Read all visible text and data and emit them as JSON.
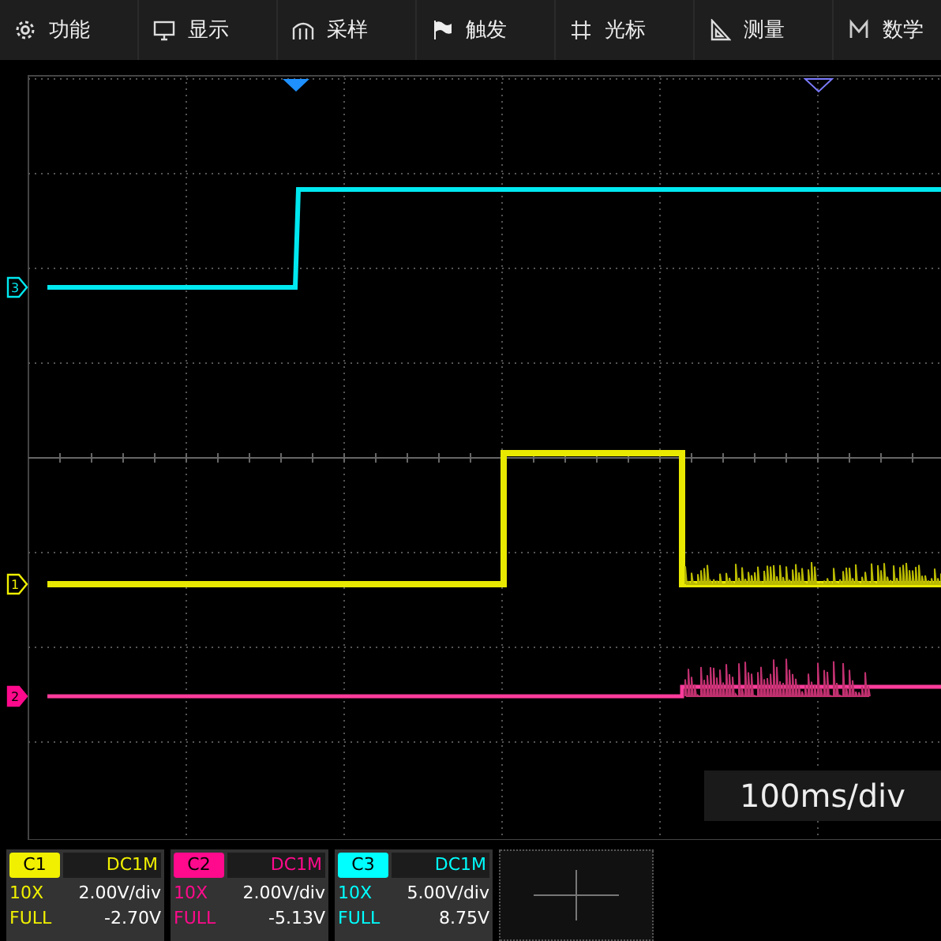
{
  "menu": [
    {
      "label": "功能"
    },
    {
      "label": "显示"
    },
    {
      "label": "采样"
    },
    {
      "label": "触发"
    },
    {
      "label": "光标"
    },
    {
      "label": "测量"
    },
    {
      "label": "数学"
    }
  ],
  "trace_markers": [
    {
      "label": "3",
      "color": "#00e8f0"
    },
    {
      "label": "1",
      "color": "#f0f000"
    },
    {
      "label": "2",
      "color": "#ff0a8c"
    }
  ],
  "timebase": "100ms/div",
  "channels": [
    {
      "label": "C1",
      "color": "#f0f000",
      "coupling": "DC1M",
      "probe": "10X",
      "scale": "2.00V/div",
      "bandwidth": "FULL",
      "offset": "-2.70V"
    },
    {
      "label": "C2",
      "color": "#ff0a8c",
      "coupling": "DC1M",
      "probe": "10X",
      "scale": "2.00V/div",
      "bandwidth": "FULL",
      "offset": "-5.13V"
    },
    {
      "label": "C3",
      "color": "#00ffff",
      "coupling": "DC1M",
      "probe": "10X",
      "scale": "5.00V/div",
      "bandwidth": "FULL",
      "offset": "8.75V"
    }
  ]
}
